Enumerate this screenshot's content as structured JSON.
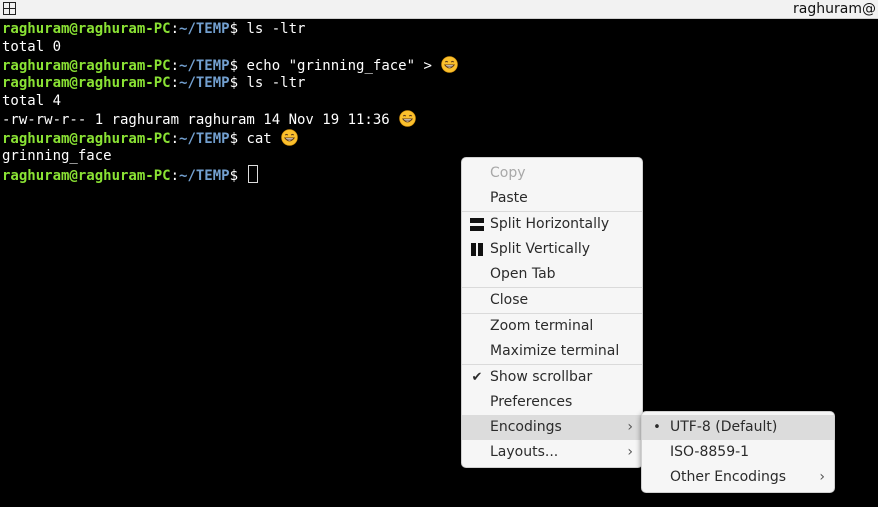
{
  "window": {
    "title": "raghuram@",
    "menu_icon": "terminator-grid-icon"
  },
  "terminal": {
    "prompt_user": "raghuram@raghuram-PC",
    "prompt_sep": ":",
    "prompt_path": "~/TEMP",
    "prompt_dollar": "$ ",
    "lines": [
      {
        "kind": "cmd",
        "text": "ls -ltr"
      },
      {
        "kind": "out",
        "text": "total 0"
      },
      {
        "kind": "cmd",
        "text": "echo \"grinning_face\" > ",
        "emoji": true
      },
      {
        "kind": "cmd",
        "text": "ls -ltr"
      },
      {
        "kind": "out",
        "text": "total 4"
      },
      {
        "kind": "out",
        "text": "-rw-rw-r-- 1 raghuram raghuram 14 Nov 19 11:36 ",
        "emoji": true
      },
      {
        "kind": "cmd",
        "text": "cat ",
        "emoji": true
      },
      {
        "kind": "out",
        "text": "grinning_face"
      },
      {
        "kind": "cmd",
        "text": "",
        "cursor": true
      }
    ],
    "emoji_icon": "grinning-face-emoji"
  },
  "context_menu": {
    "items": [
      {
        "label": "Copy",
        "disabled": true
      },
      {
        "label": "Paste"
      },
      {
        "sep": true
      },
      {
        "label": "Split Horizontally",
        "icon": "split-horizontal-icon"
      },
      {
        "label": "Split Vertically",
        "icon": "split-vertical-icon"
      },
      {
        "label": "Open Tab"
      },
      {
        "sep": true
      },
      {
        "label": "Close"
      },
      {
        "sep": true
      },
      {
        "label": "Zoom terminal"
      },
      {
        "label": "Maximize terminal"
      },
      {
        "sep": true
      },
      {
        "label": "Show scrollbar",
        "check": "✔"
      },
      {
        "label": "Preferences"
      },
      {
        "label": "Encodings",
        "submenu": true,
        "highlighted": true
      },
      {
        "label": "Layouts...",
        "submenu": true
      }
    ]
  },
  "encodings_menu": {
    "items": [
      {
        "label": "UTF-8 (Default)",
        "radio": "•",
        "highlighted": true
      },
      {
        "label": "ISO-8859-1"
      },
      {
        "label": "Other Encodings",
        "submenu": true
      }
    ]
  },
  "colors": {
    "prompt_user": "#8ae234",
    "prompt_path": "#729fcf",
    "menu_bg": "#f6f6f6",
    "highlight": "#dcdcdc"
  }
}
